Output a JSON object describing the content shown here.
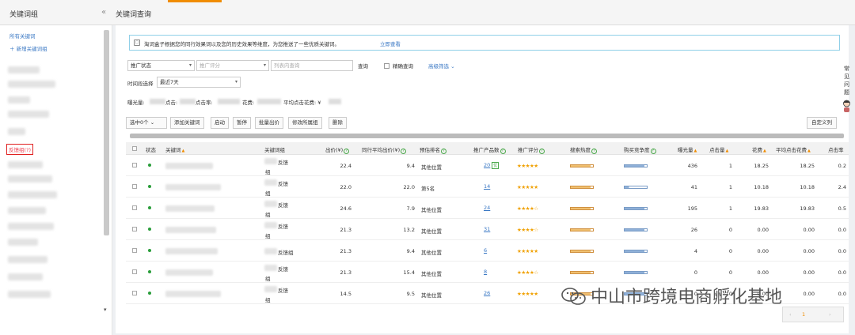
{
  "header": {
    "sidebar_title": "关键词组",
    "collapse_glyph": "«",
    "page_title": "关键词查询"
  },
  "sidebar": {
    "all_keywords": "所有关键词",
    "new_group": "＋ 新增关键词组",
    "highlighted_item": "反馈组(?)"
  },
  "notice": {
    "text": "淘词盒子根据您的同行效果词以及您的历史效果等维度，为您推送了一些优质关键词。",
    "action": "立即查看"
  },
  "filters": {
    "promo_status": "推广状态",
    "promo_score_placeholder": "推广评分",
    "keyword_input_placeholder": "列表内查询",
    "search_button": "查询",
    "exact_query": "精确查询",
    "advanced": "高级筛选",
    "time_label": "时间段选择",
    "time_value": "最近7天"
  },
  "stats": {
    "impressions": "曝光量:",
    "clicks": "点击:",
    "click_rate": "点击率:",
    "spend": "花费:",
    "avg_cpc": "平均点击花费: ¥"
  },
  "toolbar": {
    "selected": "选中0个",
    "add_keyword": "添加关键词",
    "start": "启动",
    "pause": "暂停",
    "bulk_bid": "批量出价",
    "edit_group": "修改所属组",
    "delete": "删除",
    "custom_columns": "自定义列"
  },
  "table": {
    "headers": {
      "status": "状态",
      "keyword": "关键词",
      "group": "关键词组",
      "bid": "出价(¥)",
      "peer_bid": "同行平均出价(¥)",
      "est_rank": "预估排名",
      "products": "推广产品数",
      "score": "推广评分",
      "search_heat": "搜索热度",
      "competition": "购买竞争度",
      "impressions": "曝光量",
      "clicks": "点击量",
      "spend": "花费",
      "avg_cpc": "平均点击花费",
      "ctr": "点击率"
    },
    "rows": [
      {
        "group_suffix": "反馈",
        "group_line2": "组",
        "bid": "22.4",
        "peer_bid": "9.4",
        "rank": "其他位置",
        "products": "20",
        "products_badge": "优",
        "stars": "★★★★★",
        "heat": 0.9,
        "comp": 0.9,
        "impressions": "436",
        "clicks": "1",
        "spend": "18.25",
        "avg_cpc": "18.25",
        "ctr": "0.2"
      },
      {
        "group_suffix": "反馈",
        "group_line2": "组",
        "bid": "22.0",
        "peer_bid": "22.0",
        "rank": "第5名",
        "products": "14",
        "products_badge": "",
        "stars": "★★★★★",
        "heat": 0.9,
        "comp": 0.2,
        "impressions": "41",
        "clicks": "1",
        "spend": "10.18",
        "avg_cpc": "10.18",
        "ctr": "2.4"
      },
      {
        "group_suffix": "反馈",
        "group_line2": "组",
        "bid": "24.6",
        "peer_bid": "7.9",
        "rank": "其他位置",
        "products": "24",
        "products_badge": "",
        "stars": "★★★★☆",
        "heat": 0.9,
        "comp": 0.9,
        "impressions": "195",
        "clicks": "1",
        "spend": "19.83",
        "avg_cpc": "19.83",
        "ctr": "0.5"
      },
      {
        "group_suffix": "反馈",
        "group_line2": "组",
        "bid": "21.3",
        "peer_bid": "13.2",
        "rank": "其他位置",
        "products": "31",
        "products_badge": "",
        "stars": "★★★★☆",
        "heat": 0.9,
        "comp": 0.9,
        "impressions": "26",
        "clicks": "0",
        "spend": "0.00",
        "avg_cpc": "0.00",
        "ctr": "0.0"
      },
      {
        "group_suffix": "反馈组",
        "group_line2": "",
        "bid": "21.3",
        "peer_bid": "9.4",
        "rank": "其他位置",
        "products": "6",
        "products_badge": "",
        "stars": "★★★★★",
        "heat": 0.9,
        "comp": 0.9,
        "impressions": "4",
        "clicks": "0",
        "spend": "0.00",
        "avg_cpc": "0.00",
        "ctr": "0.0"
      },
      {
        "group_suffix": "反馈",
        "group_line2": "组",
        "bid": "21.3",
        "peer_bid": "15.4",
        "rank": "其他位置",
        "products": "8",
        "products_badge": "",
        "stars": "★★★★☆",
        "heat": 0.9,
        "comp": 0.9,
        "impressions": "0",
        "clicks": "0",
        "spend": "0.00",
        "avg_cpc": "0.00",
        "ctr": "0.0"
      },
      {
        "group_suffix": "反馈",
        "group_line2": "组",
        "bid": "14.5",
        "peer_bid": "9.5",
        "rank": "其他位置",
        "products": "26",
        "products_badge": "",
        "stars": "★★★★★",
        "heat": 0.9,
        "comp": 0.9,
        "impressions": "0",
        "clicks": "0",
        "spend": "0.00",
        "avg_cpc": "0.00",
        "ctr": "0.0"
      }
    ]
  },
  "pager": {
    "prev": "‹",
    "page": "1",
    "next": "›"
  },
  "right_help": "常见问题",
  "watermark": "中山市跨境电商孵化基地",
  "colors": {
    "accent": "#f08c00",
    "link": "#3a78c4",
    "status_on": "#2a9d3a",
    "star": "#f0a000"
  }
}
